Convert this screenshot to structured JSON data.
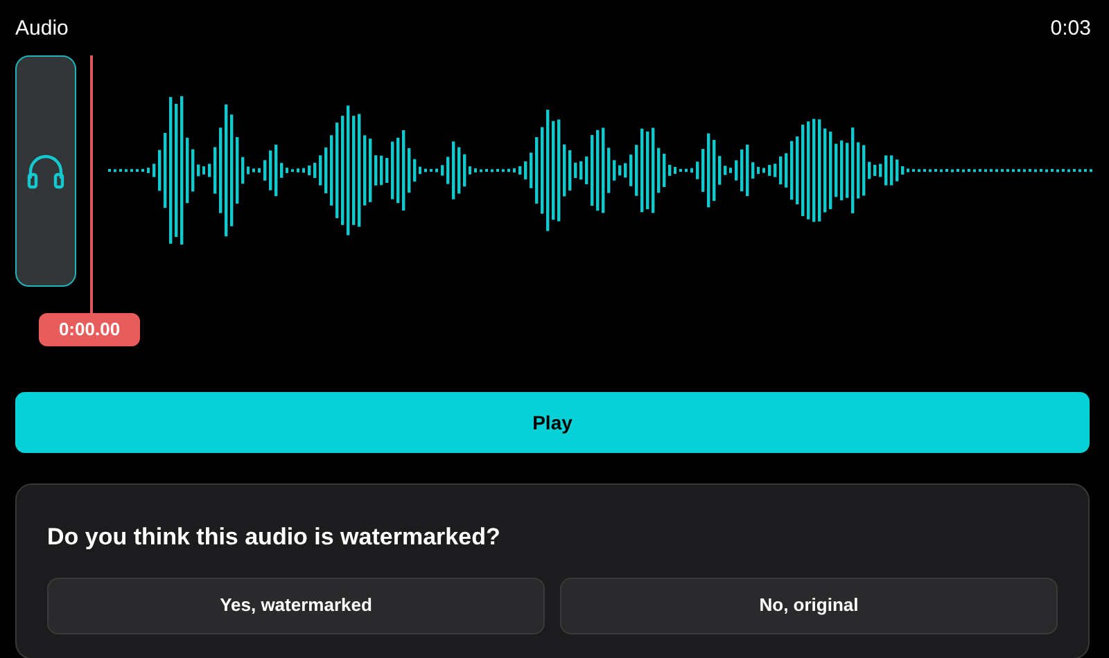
{
  "title": "Audio",
  "duration": "0:03",
  "player": {
    "kind": "picture",
    "playhead_time": "0:00.00"
  },
  "play_button": {
    "label": "Play"
  },
  "question": {
    "prompt": "Do you think this audio is watermarked?",
    "options": [
      {
        "label": "Yes, watermarked",
        "selected": false
      },
      {
        "label": "No, original",
        "selected": false
      }
    ]
  }
}
